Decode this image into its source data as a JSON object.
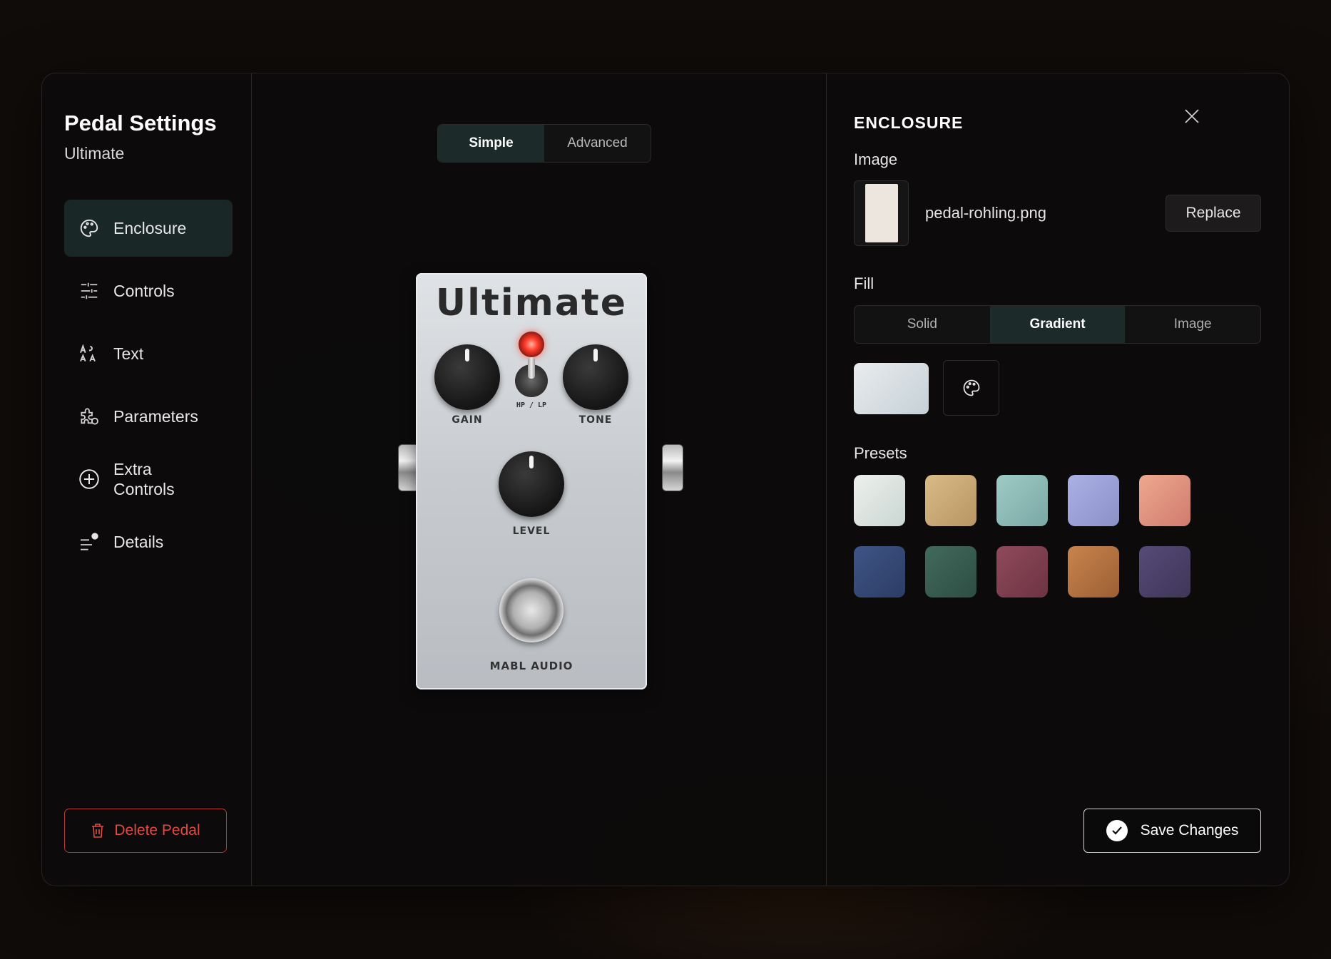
{
  "modal": {
    "title": "Pedal Settings",
    "subtitle": "Ultimate"
  },
  "nav": [
    {
      "label": "Enclosure",
      "icon": "palette-icon",
      "active": true
    },
    {
      "label": "Controls",
      "icon": "sliders-icon"
    },
    {
      "label": "Text",
      "icon": "text-icon"
    },
    {
      "label": "Parameters",
      "icon": "puzzle-icon"
    },
    {
      "label": "Extra Controls",
      "icon": "plus-circle-icon"
    },
    {
      "label": "Details",
      "icon": "info-list-icon"
    }
  ],
  "delete_label": "Delete Pedal",
  "view_toggle": {
    "simple": "Simple",
    "advanced": "Advanced",
    "selected": "Simple"
  },
  "pedal": {
    "name": "Ultimate",
    "knobs": {
      "gain": "GAIN",
      "tone": "TONE",
      "level": "LEVEL"
    },
    "switch_label": "HP / LP",
    "brand": "MABL AUDIO"
  },
  "panel": {
    "section": "ENCLOSURE",
    "image_label": "Image",
    "filename": "pedal-rohling.png",
    "replace": "Replace",
    "fill_label": "Fill",
    "fill_options": [
      "Solid",
      "Gradient",
      "Image"
    ],
    "fill_selected": "Gradient",
    "presets_label": "Presets",
    "presets": [
      {
        "name": "preset-white",
        "color": "linear-gradient(135deg,#eef0ec,#c9d6d2)"
      },
      {
        "name": "preset-tan",
        "color": "linear-gradient(135deg,#d9bb86,#b89564)"
      },
      {
        "name": "preset-teal",
        "color": "linear-gradient(135deg,#9fcbc5,#7aa8a5)"
      },
      {
        "name": "preset-lavender",
        "color": "linear-gradient(135deg,#aab1e4,#8c90c8)"
      },
      {
        "name": "preset-salmon",
        "color": "linear-gradient(135deg,#eda98f,#d17a6e)"
      },
      {
        "name": "preset-navy",
        "color": "linear-gradient(135deg,#3f5587,#2c3c64)"
      },
      {
        "name": "preset-forest",
        "color": "linear-gradient(135deg,#416a5c,#2e4e43)"
      },
      {
        "name": "preset-wine",
        "color": "linear-gradient(135deg,#904a5c,#6c3443)"
      },
      {
        "name": "preset-copper",
        "color": "linear-gradient(135deg,#c8844e,#9c5f33)"
      },
      {
        "name": "preset-plum",
        "color": "linear-gradient(135deg,#564a78,#3f3658)"
      }
    ],
    "save": "Save Changes"
  }
}
